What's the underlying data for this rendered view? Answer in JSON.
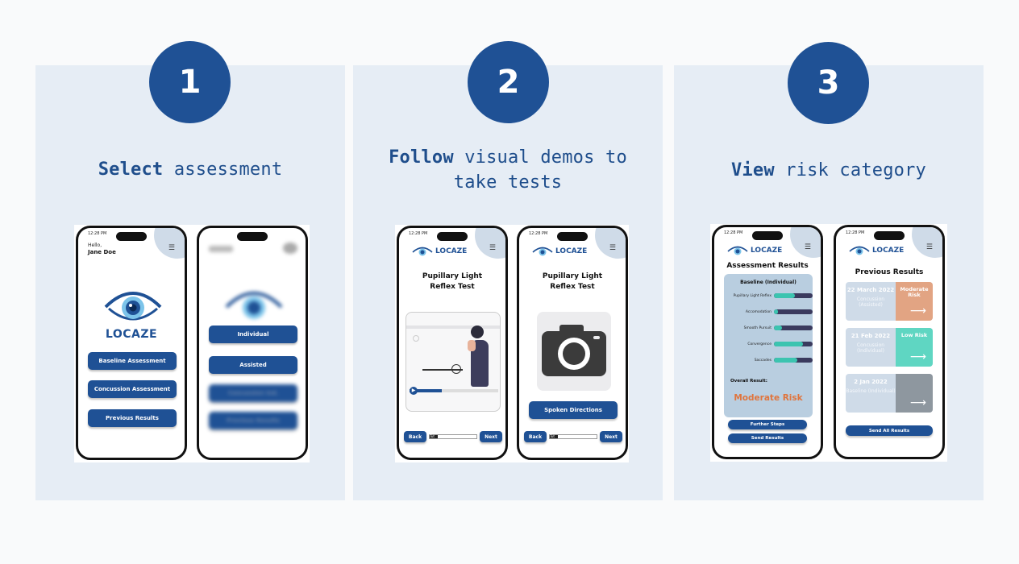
{
  "steps": [
    {
      "number": "1",
      "bold": "Select",
      "rest": " assessment",
      "rest2": ""
    },
    {
      "number": "2",
      "bold": "Follow",
      "rest": " visual demos to",
      "rest2": "take tests"
    },
    {
      "number": "3",
      "bold": "View",
      "rest": " risk category",
      "rest2": ""
    }
  ],
  "status_time": "12:28 PM",
  "brand": "LOCAZE",
  "s1": {
    "greeting": "Hello,",
    "user": "Jane Doe",
    "buttons": [
      "Baseline Assessment",
      "Concussion Assessment",
      "Previous Results"
    ],
    "options": [
      "Individual",
      "Assisted"
    ],
    "blurred": [
      "Concussion Ind.",
      "Previous Results"
    ]
  },
  "s2": {
    "title_line1": "Pupillary Light",
    "title_line2": "Reflex Test",
    "back": "Back",
    "next": "Next",
    "progress_label": "Tut",
    "spoken": "Spoken Directions"
  },
  "s3": {
    "results_title": "Assessment Results",
    "baseline_label": "Baseline (Individual)",
    "metrics": [
      {
        "label": "Pupillary Light Reflex",
        "value": 0.55
      },
      {
        "label": "Accomodation",
        "value": 0.1
      },
      {
        "label": "Smooth Pursuit",
        "value": 0.2
      },
      {
        "label": "Convergence",
        "value": 0.75
      },
      {
        "label": "Saccades",
        "value": 0.6
      }
    ],
    "overall_label": "Overall Result:",
    "overall_value": "Moderate Risk",
    "further_steps": "Further Steps",
    "send_results": "Send Results",
    "previous_title": "Previous Results",
    "history": [
      {
        "date": "22 March 2022",
        "type": "Concussion (Assisted)",
        "risk": "Moderate Risk",
        "color": "#e2a483"
      },
      {
        "date": "21 Feb 2022",
        "type": "Concussion (Individual)",
        "risk": "Low Risk",
        "color": "#5fd6c2"
      },
      {
        "date": "2 Jan 2022",
        "type": "Baseline (Individual)",
        "risk": "",
        "color": "#8e979f"
      }
    ],
    "send_all": "Send All Results"
  },
  "colors": {
    "brand": "#1f5195",
    "panel": "#e6edf5",
    "accent_risk": "#e0743c",
    "bar_fill": "#3cc4b0"
  }
}
